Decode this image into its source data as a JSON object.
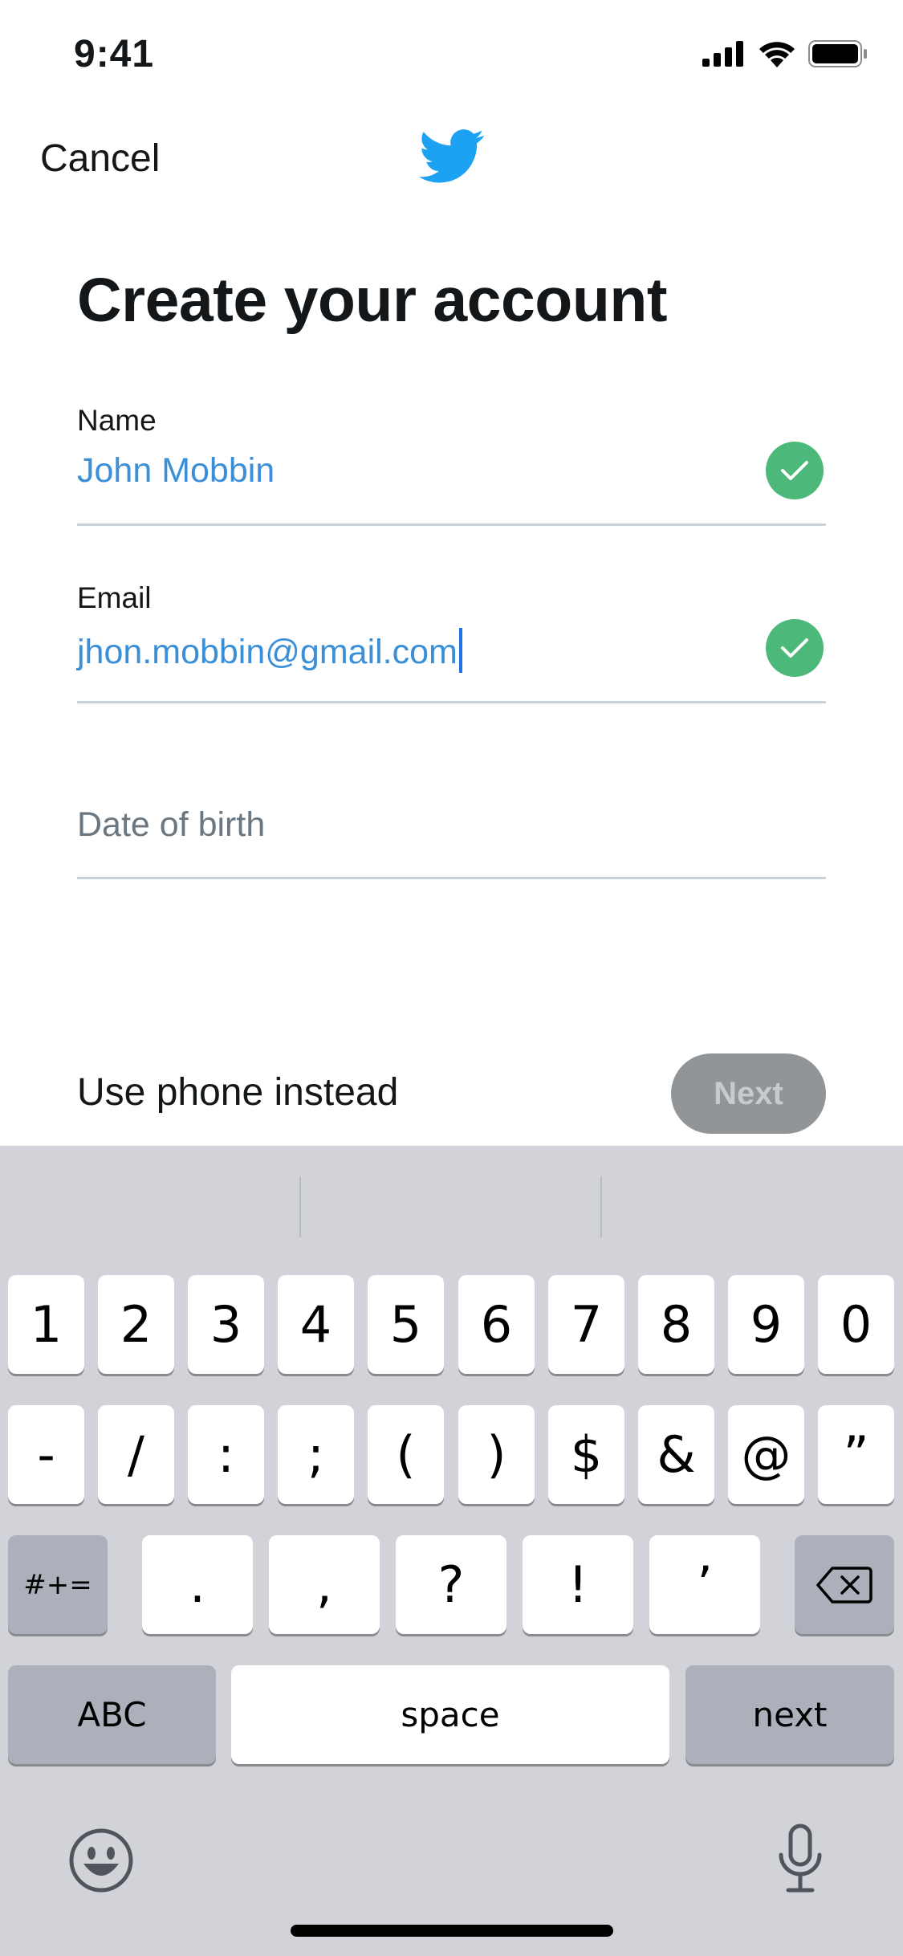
{
  "status_bar": {
    "time": "9:41"
  },
  "header": {
    "cancel_label": "Cancel"
  },
  "title": "Create your account",
  "fields": {
    "name": {
      "label": "Name",
      "value": "John Mobbin"
    },
    "email": {
      "label": "Email",
      "value": "jhon.mobbin@gmail.com"
    },
    "dob": {
      "placeholder": "Date of birth"
    }
  },
  "bottom": {
    "phone_link": "Use phone instead",
    "next_label": "Next"
  },
  "keyboard": {
    "row1": [
      "1",
      "2",
      "3",
      "4",
      "5",
      "6",
      "7",
      "8",
      "9",
      "0"
    ],
    "row2": [
      "-",
      "/",
      ":",
      ";",
      "(",
      ")",
      "$",
      "&",
      "@",
      "”"
    ],
    "row3": [
      ".",
      ",",
      "?",
      "!",
      "’"
    ],
    "symbols_label": "#+=",
    "abc_label": "ABC",
    "space_label": "space",
    "return_label": "next"
  },
  "colors": {
    "brand": "#1da1f2",
    "check": "#4cb879",
    "value_text": "#3a8fd8"
  }
}
